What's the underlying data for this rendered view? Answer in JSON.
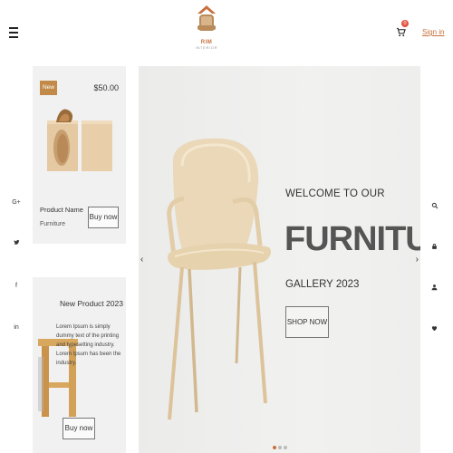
{
  "header": {
    "logo_name": "RIM",
    "logo_sub": "INTERIOR",
    "cart_count": "0",
    "signin_label": "Sign in"
  },
  "social_left": [
    {
      "icon": "google-plus-icon",
      "glyph": "G+"
    },
    {
      "icon": "twitter-icon",
      "glyph": "🐦"
    },
    {
      "icon": "facebook-icon",
      "glyph": "f"
    },
    {
      "icon": "linkedin-icon",
      "glyph": "in"
    }
  ],
  "side_right": [
    {
      "icon": "search-icon"
    },
    {
      "icon": "lock-icon"
    },
    {
      "icon": "user-icon"
    },
    {
      "icon": "heart-icon"
    }
  ],
  "product1": {
    "badge": "New",
    "price": "$50.00",
    "name": "Product Name",
    "category": "Furniture",
    "buy_label": "Buy now"
  },
  "product2": {
    "title": "New Product 2023",
    "description": "Lorem Ipsum is simply dummy text of the printing and typesetting industry. Lorem Ipsum has been the industry.",
    "buy_label": "Buy now"
  },
  "hero": {
    "welcome": "WELCOME TO OUR",
    "headline": "FURNITURE",
    "gallery": "GALLERY 2023",
    "shop_label": "SHOP NOW",
    "slide_count": 3,
    "active_slide": 1
  },
  "colors": {
    "accent": "#c7703e",
    "badge": "#c28a49",
    "card_bg": "#f1f1f1",
    "hero_bg": "#eeeeed"
  }
}
